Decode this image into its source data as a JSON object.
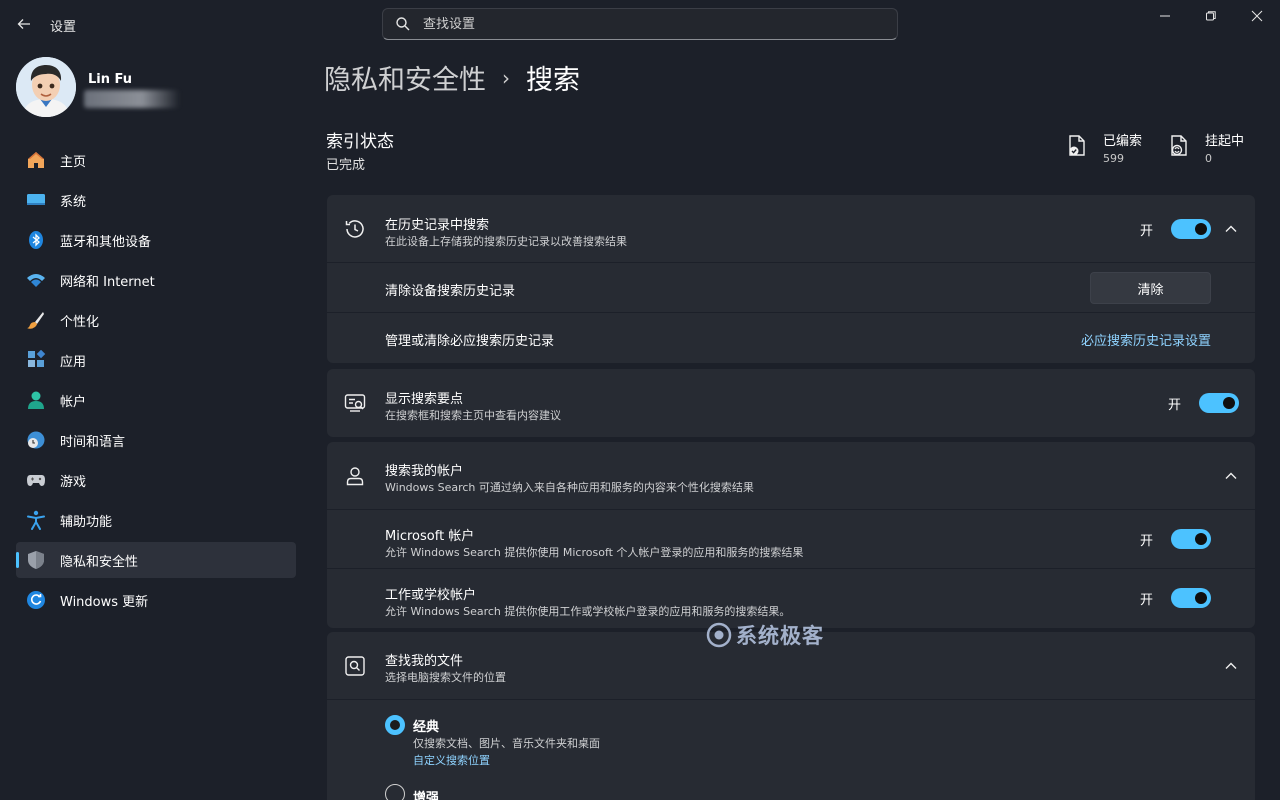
{
  "window": {
    "title": "设置",
    "search_placeholder": "查找设置"
  },
  "profile": {
    "name": "Lin Fu"
  },
  "sidebar": {
    "items": [
      {
        "label": "主页",
        "icon": "home-icon"
      },
      {
        "label": "系统",
        "icon": "system-icon"
      },
      {
        "label": "蓝牙和其他设备",
        "icon": "bluetooth-icon"
      },
      {
        "label": "网络和 Internet",
        "icon": "wifi-icon"
      },
      {
        "label": "个性化",
        "icon": "brush-icon"
      },
      {
        "label": "应用",
        "icon": "apps-icon"
      },
      {
        "label": "帐户",
        "icon": "account-icon"
      },
      {
        "label": "时间和语言",
        "icon": "clock-globe-icon"
      },
      {
        "label": "游戏",
        "icon": "gamepad-icon"
      },
      {
        "label": "辅助功能",
        "icon": "accessibility-icon"
      },
      {
        "label": "隐私和安全性",
        "icon": "shield-icon",
        "active": true
      },
      {
        "label": "Windows 更新",
        "icon": "update-icon"
      }
    ]
  },
  "breadcrumb": {
    "parent": "隐私和安全性",
    "separator": "›",
    "current": "搜索"
  },
  "index": {
    "title": "索引状态",
    "status": "已完成",
    "indexed_label": "已编索",
    "indexed_value": "599",
    "pending_label": "挂起中",
    "pending_value": "0"
  },
  "history": {
    "title": "在历史记录中搜索",
    "desc": "在此设备上存储我的搜索历史记录以改善搜索结果",
    "toggle_label": "开",
    "clear_title": "清除设备搜索历史记录",
    "clear_button": "清除",
    "manage_title": "管理或清除必应搜索历史记录",
    "manage_link": "必应搜索历史记录设置"
  },
  "highlights": {
    "title": "显示搜索要点",
    "desc": "在搜索框和搜索主页中查看内容建议",
    "toggle_label": "开"
  },
  "accounts": {
    "title": "搜索我的帐户",
    "desc": "Windows Search 可通过纳入来自各种应用和服务的内容来个性化搜索结果",
    "ms_title": "Microsoft 帐户",
    "ms_desc": "允许 Windows Search 提供你使用 Microsoft 个人帐户登录的应用和服务的搜索结果",
    "ms_toggle": "开",
    "work_title": "工作或学校帐户",
    "work_desc": "允许 Windows Search 提供你使用工作或学校帐户登录的应用和服务的搜索结果。",
    "work_toggle": "开"
  },
  "files": {
    "title": "查找我的文件",
    "desc": "选择电脑搜索文件的位置",
    "classic_title": "经典",
    "classic_desc": "仅搜索文档、图片、音乐文件夹和桌面",
    "classic_link": "自定义搜索位置",
    "enhanced_title": "增强"
  },
  "watermark": {
    "text": "系统极客"
  },
  "colors": {
    "accent": "#4cc2ff",
    "background": "#1c2029",
    "card": "#272b33"
  }
}
